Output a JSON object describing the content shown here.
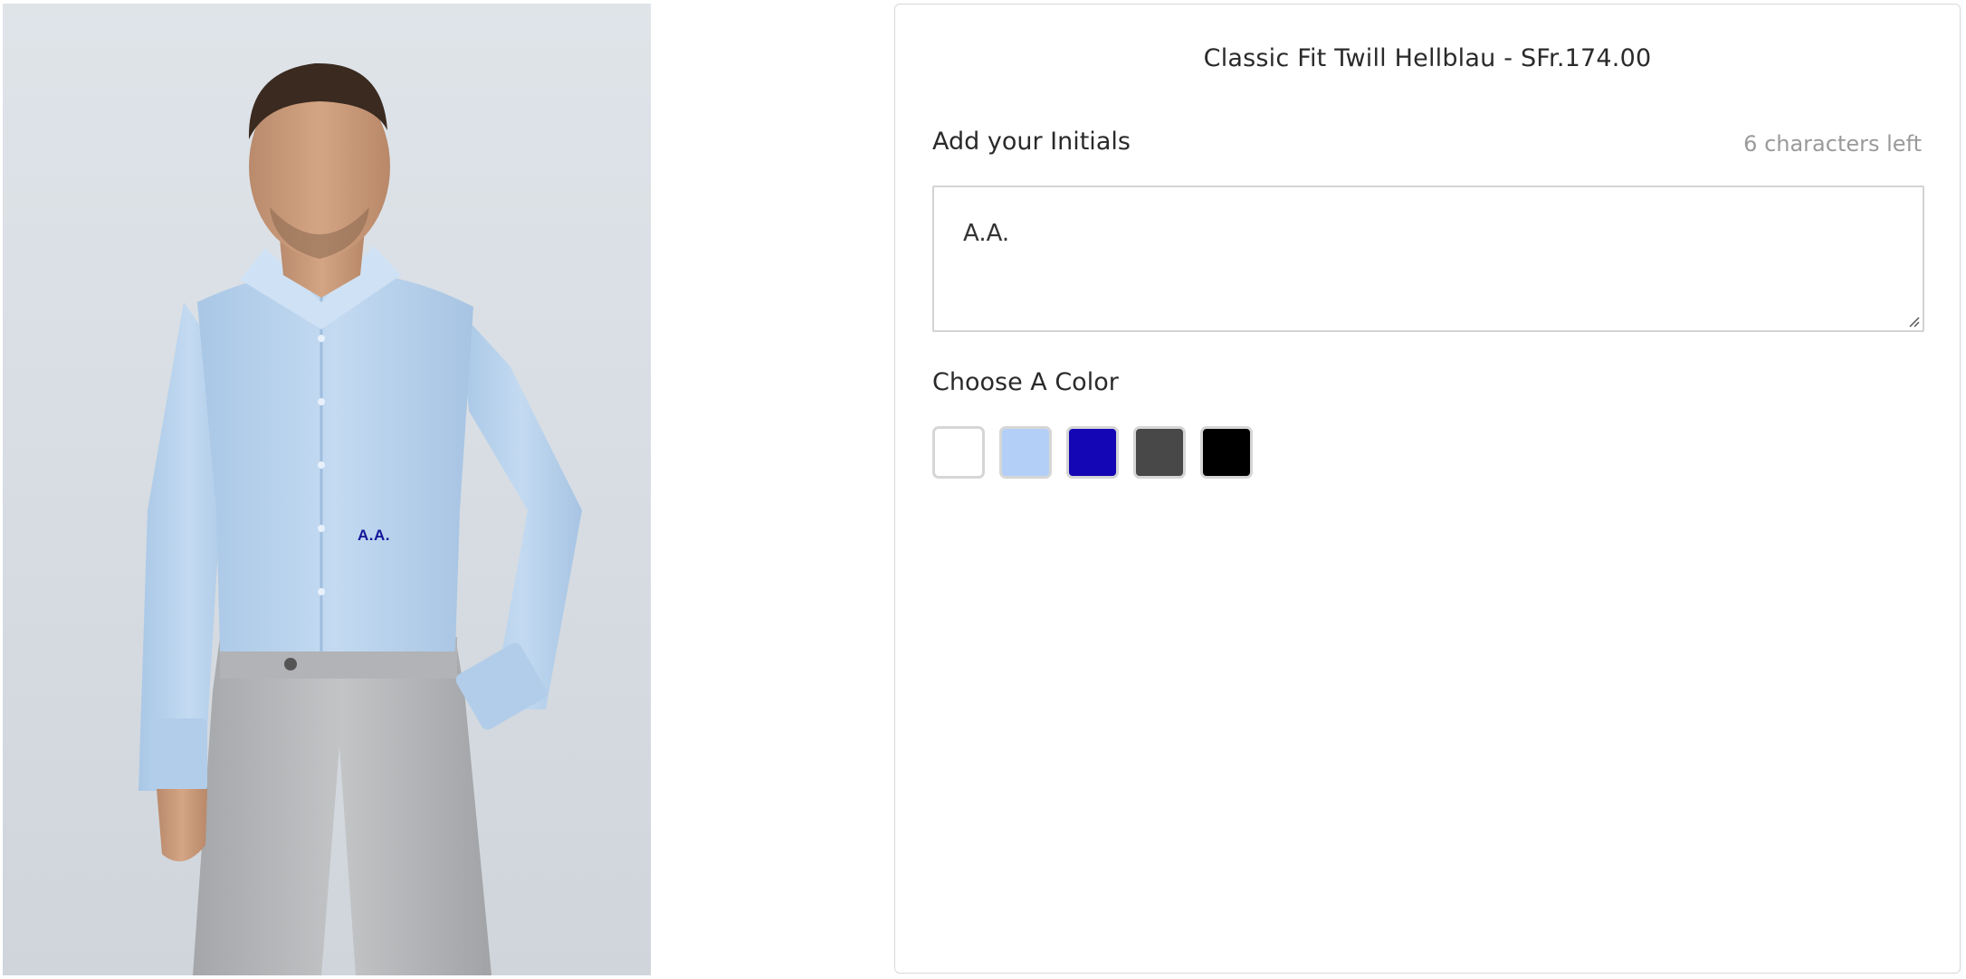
{
  "product": {
    "title": "Classic Fit Twill Hellblau - SFr.174.00",
    "image": {
      "alt_icon": "shirt-model-photo",
      "monogram_preview": "A.A."
    }
  },
  "initials": {
    "label": "Add your Initials",
    "chars_left": "6 characters left",
    "value": "A.A."
  },
  "color": {
    "label": "Choose A Color",
    "swatches": [
      {
        "name": "white",
        "hex": "#ffffff"
      },
      {
        "name": "light-blue",
        "hex": "#b3cff7"
      },
      {
        "name": "royal-blue",
        "hex": "#1406b4"
      },
      {
        "name": "dark-grey",
        "hex": "#484848"
      },
      {
        "name": "black",
        "hex": "#000000"
      }
    ]
  }
}
